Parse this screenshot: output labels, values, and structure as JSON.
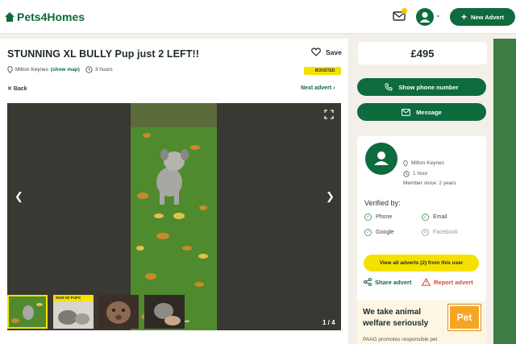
{
  "header": {
    "logo_text": "Pets4Homes",
    "new_advert_label": "New Advert"
  },
  "ad": {
    "title": "STUNNING XL BULLY Pup just 2 LEFT!!",
    "save_label": "Save",
    "location": "Milton Keynes",
    "show_map_label": "(show map)",
    "posted": "3 hours",
    "boost_label": "BOOSTED",
    "back_label": "Back",
    "next_label": "Next advert",
    "image_counter": "1 / 4",
    "thumb_caption": "MUM W/ PUPS"
  },
  "sidebar": {
    "price": "£495",
    "phone_label": "Show phone number",
    "message_label": "Message",
    "seller_location": "Milton Keynes",
    "seller_active": "1 hour",
    "member_since": "Member since: 2 years",
    "verified_title": "Verified by:",
    "verified": [
      {
        "label": "Phone",
        "verified": true
      },
      {
        "label": "Email",
        "verified": true
      },
      {
        "label": "Google",
        "verified": true
      },
      {
        "label": "Facebook",
        "verified": false
      }
    ],
    "view_all_label": "View all adverts (2) from this user",
    "share_label": "Share advert",
    "report_label": "Report advert"
  },
  "welfare": {
    "title": "We take animal welfare seriously",
    "logo_text": "Pet",
    "text": "PAAG promotes responsible pet"
  },
  "colors": {
    "brand_green": "#0e6b3e",
    "accent_yellow": "#f5e100",
    "report_red": "#d24a3d"
  }
}
